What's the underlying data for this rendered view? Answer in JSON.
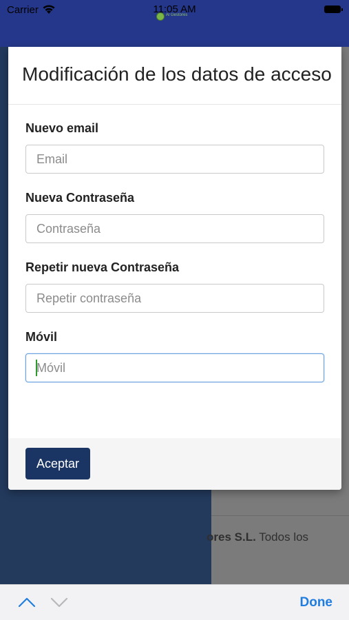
{
  "status_bar": {
    "carrier": "Carrier",
    "time": "11:05 AM",
    "logo_text": "Al Gestores"
  },
  "background": {
    "footer_bold": "ores S.L.",
    "footer_rest": " Todos los"
  },
  "modal": {
    "title": "Modificación de los datos de acceso",
    "fields": [
      {
        "label": "Nuevo email",
        "placeholder": "Email",
        "value": ""
      },
      {
        "label": "Nueva Contraseña",
        "placeholder": "Contraseña",
        "value": ""
      },
      {
        "label": "Repetir nueva Contraseña",
        "placeholder": "Repetir contraseña",
        "value": ""
      },
      {
        "label": "Móvil",
        "placeholder": "Móvil",
        "value": ""
      }
    ],
    "accept_label": "Aceptar"
  },
  "accessory_bar": {
    "done_label": "Done"
  },
  "colors": {
    "header_blue": "#25378a",
    "button_navy": "#1a3563",
    "done_blue": "#1f7de0"
  }
}
